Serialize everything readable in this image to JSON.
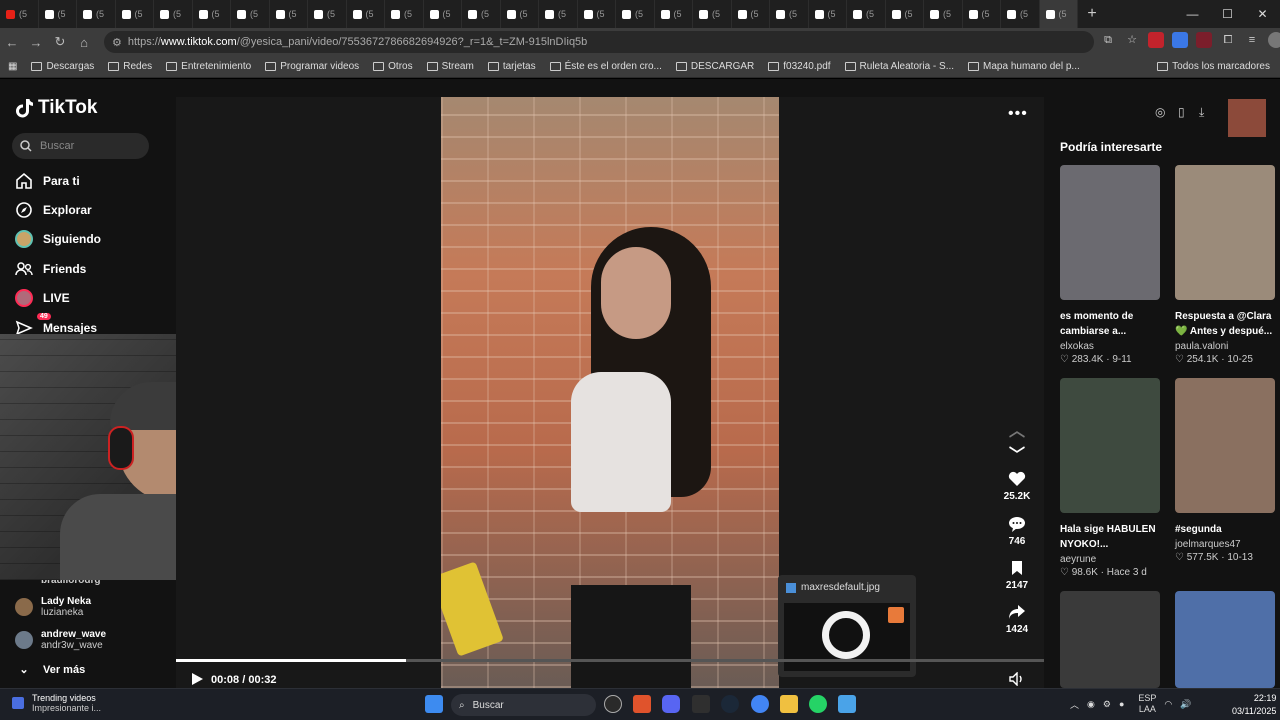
{
  "browser": {
    "tab_label": "(5",
    "tab_count": 28,
    "active_tab_label": "(5",
    "new_tab": "+",
    "url_prefix": "https://",
    "url_host": "www.tiktok.com",
    "url_path": "/@yesica_pani/video/7553672786682694926?_r=1&_t=ZM-915lnDIiq5b",
    "controls": [
      "—",
      "☐",
      "✕"
    ]
  },
  "bookmarks": {
    "items": [
      "Descargas",
      "Redes",
      "Entretenimiento",
      "Programar videos",
      "Otros",
      "Stream",
      "tarjetas",
      "Éste es el orden cro...",
      "DESCARGAR",
      "f03240.pdf",
      "Ruleta Aleatoria - S...",
      "Mapa humano del p..."
    ],
    "all_bookmarks": "Todos los marcadores"
  },
  "sidebar": {
    "logo": "TikTok",
    "search_placeholder": "Buscar",
    "nav": [
      "Para ti",
      "Explorar",
      "Siguiendo",
      "Friends",
      "LIVE",
      "Mensajes"
    ],
    "messages_badge": "49",
    "following": [
      {
        "name": "brauliorodrg",
        "handle": ""
      },
      {
        "name": "Lady Neka",
        "handle": "luzianeka"
      },
      {
        "name": "andrew_wave",
        "handle": "andr3w_wave"
      }
    ],
    "see_more": "Ver más"
  },
  "video": {
    "likes": "25.2K",
    "comments": "746",
    "saves": "2147",
    "shares": "1424",
    "time_current": "00:08",
    "time_total": "00:32",
    "time_separator": "/",
    "progress": 0.265
  },
  "preview": {
    "filename": "maxresdefault.jpg"
  },
  "recommendations": {
    "title": "Podría interesarte",
    "items": [
      {
        "title": "es momento de cambiarse a...",
        "author": "elxokas",
        "stats": "♡ 283.4K · 9-11",
        "color": "#6b6a70"
      },
      {
        "title": "Respuesta a @Clara 💚 Antes y despué...",
        "author": "paula.valoni",
        "stats": "♡ 254.1K · 10-25",
        "color": "#9b8b7a"
      },
      {
        "title": "Hala sige HABULEN NYOKO!...",
        "author": "aeyrune",
        "stats": "♡ 98.6K · Hace 3 d",
        "color": "#3e4a3f"
      },
      {
        "title": "#segunda",
        "author": "joelmarques47",
        "stats": "♡ 577.5K · 10-13",
        "color": "#8a7060"
      },
      {
        "title": "",
        "author": "",
        "stats": "",
        "color": "#3a3a3a"
      },
      {
        "title": "",
        "author": "",
        "stats": "",
        "color": "#4f6fa8"
      }
    ]
  },
  "taskbar": {
    "trending_title": "Trending videos",
    "trending_sub": "Impresionante i...",
    "search": "Buscar",
    "lang_1": "ESP",
    "lang_2": "LAA",
    "time": "22:19",
    "date": "03/11/2025"
  }
}
